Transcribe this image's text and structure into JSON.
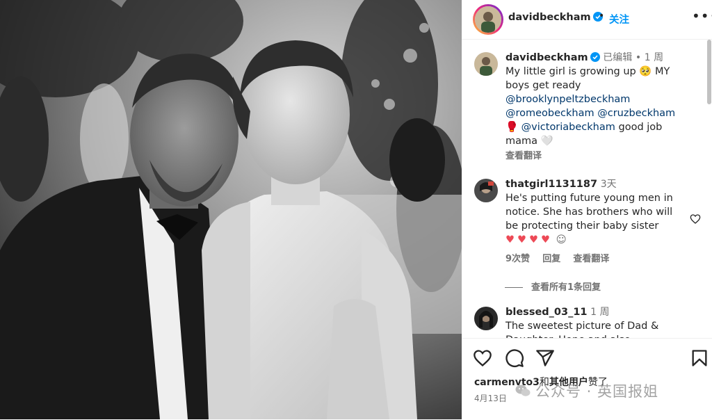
{
  "post": {
    "username": "davidbeckham",
    "follow_label": "关注",
    "dot": "•",
    "more_label": "•••"
  },
  "caption": {
    "username": "davidbeckham",
    "edited": "已编辑",
    "dot": "•",
    "time": "1 周",
    "text_1": "My little girl is growing up",
    "emoji_1": "🥺",
    "text_2": "MY boys get ready",
    "mention_1": "@brooklynpeltzbeckham",
    "mention_2": "@romeobeckham",
    "mention_3": "@cruzbeckham",
    "emoji_2": "🥊",
    "mention_4": "@victoriabeckham",
    "text_3": "good job mama",
    "emoji_3": "🤍",
    "translate_label": "查看翻译"
  },
  "comments": [
    {
      "username": "thatgirl1131187",
      "time": "3天",
      "text": "He's putting future young men in notice. She has brothers who will be protecting their baby sister",
      "emojis": "♥♥♥♥",
      "emoji_tail": "☺",
      "likes": "9次赞",
      "reply_label": "回复",
      "translate_label": "查看翻译"
    },
    {
      "username": "blessed_03_11",
      "time": "1 周",
      "text": "The sweetest picture of Dad & Daughter. Hope and also happiness!"
    }
  ],
  "view_replies": "查看所有1条回复",
  "likes": {
    "user": "carmenvto3",
    "joiner": "和",
    "others": "其他用户",
    "suffix": "赞了"
  },
  "date": "4月13日",
  "watermark": {
    "text": "公众号 · 英国报姐"
  },
  "colors": {
    "link": "#0095f6",
    "mention": "#00376b",
    "like_red": "#ed4956",
    "verified": "#0095f6"
  },
  "icons": [
    "verified-icon",
    "heart-icon",
    "comment-icon",
    "share-icon",
    "bookmark-icon",
    "more-icon",
    "wechat-icon"
  ]
}
